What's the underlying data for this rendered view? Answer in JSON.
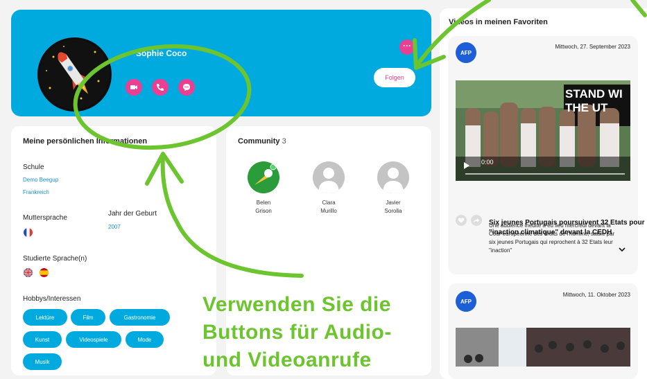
{
  "profile": {
    "name": "Sophie Coco",
    "follow_label": "Folgen",
    "more_label": "···"
  },
  "info": {
    "title": "Meine persönlichen Informationen",
    "school_label": "Schule",
    "school_name": "Demo Beegup",
    "school_country": "Frankreich",
    "mother_tongue_label": "Muttersprache",
    "birth_year_label": "Jahr der Geburt",
    "birth_year": "2007",
    "studied_label": "Studierte Sprache(n)",
    "hobbies_label": "Hobbys/Interessen",
    "hobbies": [
      "Lektüre",
      "Film",
      "Gastronomie",
      "Kunst",
      "Videospiele",
      "Mode",
      "Musik"
    ]
  },
  "community": {
    "title": "Community",
    "count": "3",
    "members": [
      {
        "first": "Belen",
        "last": "Grison"
      },
      {
        "first": "Clara",
        "last": "Murillo"
      },
      {
        "first": "Javier",
        "last": "Sorolla"
      }
    ]
  },
  "favorites": {
    "title": "Videos in meinen Favoriten",
    "source_logo": "AFP",
    "video1": {
      "date": "Mittwoch, 27. September 2023",
      "overlay_text": "STAND WI THE UT",
      "time": "0:00",
      "title": "Six jeunes Portugais poursuivent 32 Etats pour \"inaction climatique\" devant la CEDH",
      "description": "Une audience inédite a eu lieu mercredi devant la Cour européenne des droits de l'homme, saisie par six jeunes Portugais qui reprochent à 32 Etats leur \"inaction\""
    },
    "video2": {
      "date": "Mittwoch, 11. Oktober 2023"
    }
  },
  "annotation": {
    "line1": "Verwenden Sie die",
    "line2": "Buttons für Audio-",
    "line3": "und Videoanrufe"
  },
  "colors": {
    "accent_blue": "#00aadf",
    "accent_pink": "#ea3f93",
    "annotation_green": "#6cc42f"
  }
}
